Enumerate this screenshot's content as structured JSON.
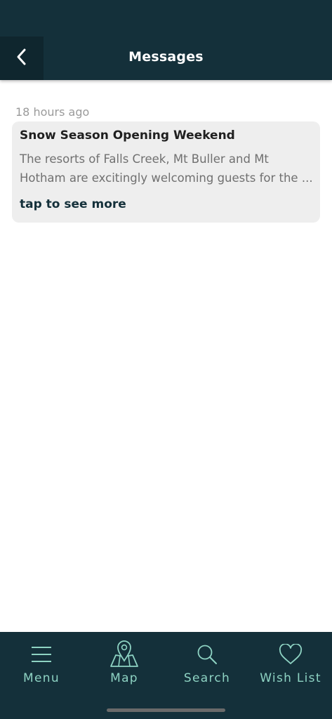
{
  "header": {
    "title": "Messages",
    "back_icon": "chevron-left-icon",
    "background": "#14303a"
  },
  "messages": [
    {
      "timestamp": "18 hours ago",
      "title": "Snow Season Opening Weekend",
      "body_line1": "The resorts of Falls Creek, Mt Buller and Mt",
      "body_line2": "Hotham are excitingly welcoming guests for the ...",
      "more_label": "tap to see more"
    }
  ],
  "nav": {
    "items": [
      {
        "label": "Menu",
        "icon": "menu-icon"
      },
      {
        "label": "Map",
        "icon": "map-pin-icon"
      },
      {
        "label": "Search",
        "icon": "search-icon"
      },
      {
        "label": "Wish List",
        "icon": "heart-icon"
      }
    ],
    "accent": "#8ed3c3"
  }
}
